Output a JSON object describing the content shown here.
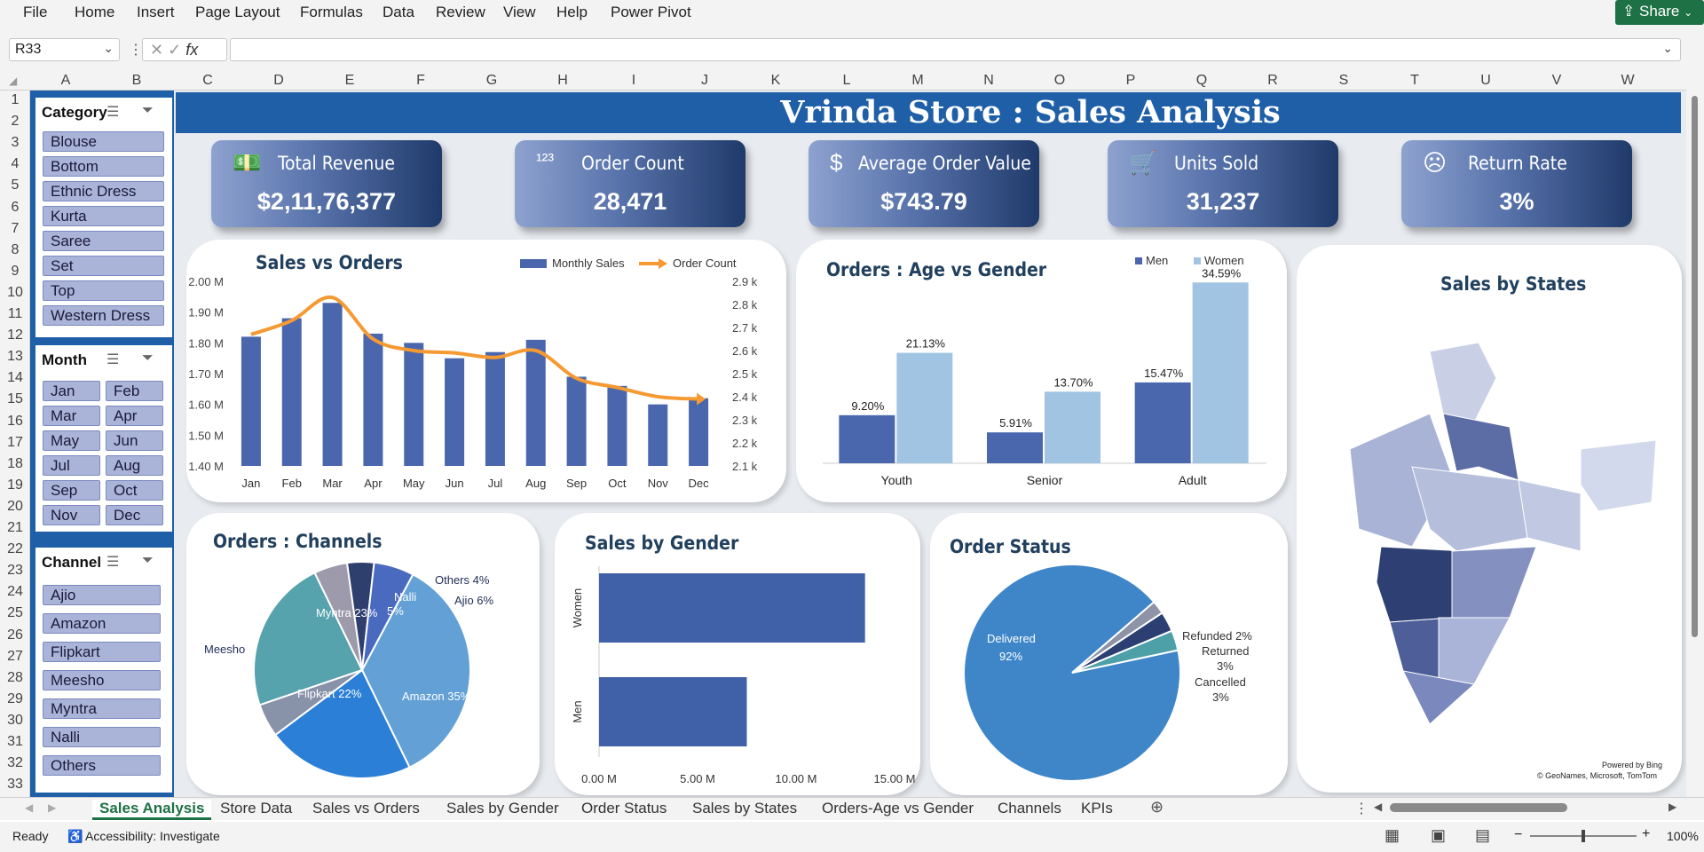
{
  "menu": [
    "File",
    "Home",
    "Insert",
    "Page Layout",
    "Formulas",
    "Data",
    "Review",
    "View",
    "Help",
    "Power Pivot"
  ],
  "share_label": "Share",
  "name_box": "R33",
  "columns": [
    "A",
    "B",
    "C",
    "D",
    "E",
    "F",
    "G",
    "H",
    "I",
    "J",
    "K",
    "L",
    "M",
    "N",
    "O",
    "P",
    "Q",
    "R",
    "S",
    "T",
    "U",
    "V",
    "W"
  ],
  "rows": [
    "1",
    "2",
    "3",
    "4",
    "5",
    "6",
    "7",
    "8",
    "9",
    "10",
    "11",
    "12",
    "13",
    "14",
    "15",
    "16",
    "17",
    "18",
    "19",
    "20",
    "21",
    "22",
    "23",
    "24",
    "25",
    "26",
    "27",
    "28",
    "29",
    "30",
    "31",
    "32",
    "33"
  ],
  "title": "Vrinda Store : Sales Analysis",
  "slicers": {
    "category": {
      "title": "Category",
      "items": [
        "Blouse",
        "Bottom",
        "Ethnic Dress",
        "Kurta",
        "Saree",
        "Set",
        "Top",
        "Western Dress"
      ]
    },
    "month": {
      "title": "Month",
      "items": [
        "Jan",
        "Feb",
        "Mar",
        "Apr",
        "May",
        "Jun",
        "Jul",
        "Aug",
        "Sep",
        "Oct",
        "Nov",
        "Dec"
      ]
    },
    "channel": {
      "title": "Channel",
      "items": [
        "Ajio",
        "Amazon",
        "Flipkart",
        "Meesho",
        "Myntra",
        "Nalli",
        "Others"
      ]
    }
  },
  "kpis": [
    {
      "title": "Total Revenue",
      "value": "$2,11,76,377",
      "icon": "money-icon"
    },
    {
      "title": "Order Count",
      "value": "28,471",
      "icon": "numbers-icon"
    },
    {
      "title": "Average Order Value",
      "value": "$743.79",
      "icon": "dollar-icon"
    },
    {
      "title": "Units Sold",
      "value": "31,237",
      "icon": "cart-icon"
    },
    {
      "title": "Return Rate",
      "value": "3%",
      "icon": "sad-face-icon"
    }
  ],
  "chart_data": [
    {
      "type": "bar",
      "title": "Sales vs Orders",
      "categories": [
        "Jan",
        "Feb",
        "Mar",
        "Apr",
        "May",
        "Jun",
        "Jul",
        "Aug",
        "Sep",
        "Oct",
        "Nov",
        "Dec"
      ],
      "series": [
        {
          "name": "Monthly Sales",
          "values": [
            1.82,
            1.88,
            1.93,
            1.83,
            1.8,
            1.75,
            1.77,
            1.81,
            1.69,
            1.66,
            1.6,
            1.62
          ],
          "axis": "left",
          "color": "#4a66ad"
        },
        {
          "name": "Order Count",
          "values": [
            2.67,
            2.73,
            2.83,
            2.65,
            2.6,
            2.59,
            2.57,
            2.6,
            2.48,
            2.44,
            2.4,
            2.39
          ],
          "axis": "right",
          "type": "line",
          "color": "#f59a32"
        }
      ],
      "ylim": [
        1.4,
        2.0
      ],
      "yticks": [
        "2.00 M",
        "1.90 M",
        "1.80 M",
        "1.70 M",
        "1.60 M",
        "1.50 M",
        "1.40 M"
      ],
      "y2lim": [
        2.1,
        2.9
      ],
      "y2ticks": [
        "2.9 k",
        "2.8 k",
        "2.7 k",
        "2.6 k",
        "2.5 k",
        "2.4 k",
        "2.3 k",
        "2.2 k",
        "2.1 k"
      ],
      "legend": "top-right"
    },
    {
      "type": "bar",
      "title": "Orders : Age vs Gender",
      "categories": [
        "Youth",
        "Senior",
        "Adult"
      ],
      "series": [
        {
          "name": "Men",
          "values": [
            9.2,
            5.91,
            15.47
          ],
          "labels": [
            "9.20%",
            "5.91%",
            "15.47%"
          ],
          "color": "#4a66ad"
        },
        {
          "name": "Women",
          "values": [
            21.13,
            13.7,
            34.59
          ],
          "labels": [
            "21.13%",
            "13.70%",
            "34.59%"
          ],
          "color": "#a1c4e3"
        }
      ],
      "ylim": [
        0,
        36
      ],
      "legend": "top-right"
    },
    {
      "type": "pie",
      "title": "Orders : Channels",
      "labels": [
        "Amazon",
        "Flipkart",
        "Meesho",
        "Myntra",
        "Nalli",
        "Others",
        "Ajio"
      ],
      "display_labels": [
        "Amazon 35%",
        "Flipkart 22%",
        "Meesho",
        "Myntra 23%",
        "Nalli",
        "Others  4%",
        "Ajio 6%"
      ],
      "nalli_pct": "5%",
      "values": [
        35,
        22,
        5,
        23,
        5,
        4,
        6
      ],
      "colors": [
        "#62a0d6",
        "#2b7fd6",
        "#8892a8",
        "#56a2ad",
        "#9d9aac",
        "#2e3f6e",
        "#4a6ac0"
      ]
    },
    {
      "type": "bar",
      "orientation": "horizontal",
      "title": "Sales by Gender",
      "categories": [
        "Women",
        "Men"
      ],
      "values": [
        13.5,
        7.5
      ],
      "xlim": [
        0,
        15
      ],
      "xticks": [
        "0.00 M",
        "5.00 M",
        "10.00 M",
        "15.00 M"
      ]
    },
    {
      "type": "pie",
      "title": "Order Status",
      "labels": [
        "Delivered",
        "Refunded",
        "Returned",
        "Cancelled"
      ],
      "values": [
        92,
        2,
        3,
        3
      ],
      "display_labels": [
        "Delivered",
        "Refunded 2%",
        "Returned",
        "Cancelled"
      ],
      "display_pcts": [
        "92%",
        "",
        "3%",
        "3%"
      ],
      "colors": [
        "#3f86c9",
        "#8e93a8",
        "#2c3f73",
        "#4d9fa8"
      ]
    }
  ],
  "map": {
    "title": "Sales by States",
    "credit1": "Powered by Bing",
    "credit2": "© GeoNames, Microsoft, TomTom"
  },
  "tabs": [
    "Sales Analysis",
    "Store Data",
    "Sales vs Orders",
    "Sales by Gender",
    "Order Status",
    "Sales by States",
    "Orders-Age vs Gender",
    "Channels",
    "KPIs"
  ],
  "status": {
    "ready": "Ready",
    "accessibility": "Accessibility: Investigate",
    "zoom": "100%"
  }
}
